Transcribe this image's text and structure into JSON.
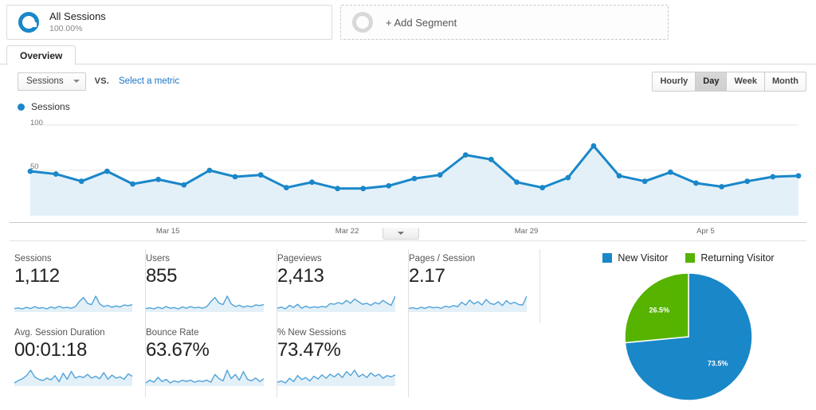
{
  "segment_bar": {
    "all_sessions": {
      "icon": "donut-icon",
      "title": "All Sessions",
      "percent": "100.00%"
    },
    "add_segment": {
      "icon": "donut-outline-icon",
      "label": "+ Add Segment"
    }
  },
  "tabs": [
    {
      "label": "Overview",
      "active": true
    }
  ],
  "metric_controls": {
    "primary_metric": "Sessions",
    "vs_label": "VS.",
    "select_metric_link": "Select a metric",
    "granularity": [
      {
        "label": "Hourly",
        "active": false
      },
      {
        "label": "Day",
        "active": true
      },
      {
        "label": "Week",
        "active": false
      },
      {
        "label": "Month",
        "active": false
      }
    ]
  },
  "chart_data": [
    {
      "id": "sessions-timeline",
      "type": "line",
      "title": "Sessions",
      "legend": [
        "Sessions"
      ],
      "legend_position": "top-left",
      "series_color": "#1a87c9",
      "fill_color": "#e3f0f8",
      "grid": true,
      "xlabel": "",
      "ylabel": "",
      "ylim": [
        0,
        100
      ],
      "yticks": [
        50,
        100
      ],
      "ytick_labels": [
        "50",
        "100"
      ],
      "xtick_labels": [
        "Mar 15",
        "Mar 22",
        "Mar 29",
        "Apr 5"
      ],
      "xtick_indices": [
        5,
        12,
        19,
        26
      ],
      "x": [
        "Mar 10",
        "Mar 11",
        "Mar 12",
        "Mar 13",
        "Mar 14",
        "Mar 15",
        "Mar 16",
        "Mar 17",
        "Mar 18",
        "Mar 19",
        "Mar 20",
        "Mar 21",
        "Mar 22",
        "Mar 23",
        "Mar 24",
        "Mar 25",
        "Mar 26",
        "Mar 27",
        "Mar 28",
        "Mar 29",
        "Mar 30",
        "Mar 31",
        "Apr 1",
        "Apr 2",
        "Apr 3",
        "Apr 4",
        "Apr 5",
        "Apr 6",
        "Apr 7",
        "Apr 8",
        "Apr 9"
      ],
      "series": [
        {
          "name": "Sessions",
          "values": [
            49,
            46,
            38,
            49,
            35,
            40,
            34,
            50,
            43,
            45,
            31,
            37,
            30,
            30,
            33,
            41,
            45,
            67,
            62,
            37,
            31,
            42,
            77,
            44,
            38,
            48,
            36,
            32,
            38,
            43,
            44
          ]
        }
      ]
    },
    {
      "id": "new-vs-returning-pie",
      "type": "pie",
      "title": "",
      "legend_position": "top",
      "labels": [
        "New Visitor",
        "Returning Visitor"
      ],
      "values": [
        73.5,
        26.5
      ],
      "value_labels": [
        "73.5%",
        "26.5%"
      ],
      "colors": [
        "#1a87c9",
        "#56b300"
      ]
    },
    {
      "id": "sessions-spark",
      "type": "line",
      "values": [
        18,
        20,
        17,
        22,
        18,
        24,
        19,
        21,
        17,
        23,
        19,
        25,
        20,
        22,
        19,
        24,
        40,
        52,
        34,
        30,
        56,
        32,
        24,
        28,
        22,
        26,
        23,
        29,
        27,
        30
      ]
    },
    {
      "id": "users-spark",
      "type": "line",
      "values": [
        17,
        19,
        16,
        21,
        17,
        23,
        18,
        20,
        16,
        22,
        18,
        23,
        19,
        21,
        18,
        23,
        38,
        50,
        33,
        29,
        54,
        31,
        23,
        27,
        21,
        25,
        22,
        28,
        26,
        29
      ]
    },
    {
      "id": "pageviews-spark",
      "type": "line",
      "values": [
        22,
        25,
        20,
        30,
        24,
        33,
        22,
        28,
        23,
        26,
        24,
        27,
        25,
        35,
        33,
        38,
        34,
        44,
        36,
        48,
        40,
        33,
        36,
        30,
        38,
        34,
        44,
        36,
        30,
        56
      ]
    },
    {
      "id": "pages-session-spark",
      "type": "line",
      "values": [
        18,
        19,
        17,
        20,
        18,
        21,
        19,
        20,
        18,
        22,
        20,
        23,
        21,
        29,
        24,
        33,
        26,
        30,
        24,
        34,
        27,
        25,
        30,
        23,
        32,
        26,
        29,
        25,
        24,
        40
      ]
    },
    {
      "id": "avg-duration-spark",
      "type": "line",
      "values": [
        14,
        22,
        28,
        38,
        56,
        34,
        26,
        22,
        30,
        24,
        38,
        18,
        46,
        26,
        52,
        30,
        36,
        32,
        42,
        30,
        36,
        28,
        48,
        26,
        40,
        30,
        34,
        26,
        44,
        36
      ]
    },
    {
      "id": "bounce-rate-spark",
      "type": "line",
      "values": [
        26,
        30,
        27,
        34,
        28,
        31,
        26,
        29,
        27,
        30,
        28,
        30,
        27,
        29,
        28,
        30,
        27,
        38,
        32,
        29,
        44,
        32,
        38,
        30,
        42,
        31,
        29,
        33,
        28,
        32
      ]
    },
    {
      "id": "new-sessions-spark",
      "type": "line",
      "values": [
        22,
        24,
        21,
        28,
        23,
        32,
        26,
        29,
        24,
        31,
        27,
        33,
        28,
        34,
        30,
        35,
        29,
        38,
        32,
        40,
        30,
        34,
        29,
        36,
        31,
        34,
        28,
        32,
        30,
        33
      ]
    }
  ],
  "metric_cards": [
    {
      "title": "Sessions",
      "value": "1,112",
      "spark": "sessions-spark"
    },
    {
      "title": "Users",
      "value": "855",
      "spark": "users-spark"
    },
    {
      "title": "Pageviews",
      "value": "2,413",
      "spark": "pageviews-spark"
    },
    {
      "title": "Pages / Session",
      "value": "2.17",
      "spark": "pages-session-spark"
    },
    {
      "title": "Avg. Session Duration",
      "value": "00:01:18",
      "spark": "avg-duration-spark"
    },
    {
      "title": "Bounce Rate",
      "value": "63.67%",
      "spark": "bounce-rate-spark"
    },
    {
      "title": "% New Sessions",
      "value": "73.47%",
      "spark": "new-sessions-spark"
    }
  ],
  "colors": {
    "accent_blue": "#1a87c9",
    "link_blue": "#1a73c8",
    "green": "#56b300",
    "area_fill": "#e3f0f8"
  }
}
